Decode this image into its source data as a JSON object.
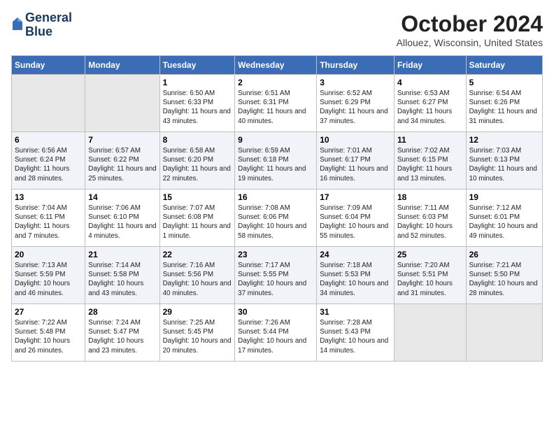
{
  "header": {
    "logo_line1": "General",
    "logo_line2": "Blue",
    "title": "October 2024",
    "subtitle": "Allouez, Wisconsin, United States"
  },
  "days_of_week": [
    "Sunday",
    "Monday",
    "Tuesday",
    "Wednesday",
    "Thursday",
    "Friday",
    "Saturday"
  ],
  "weeks": [
    [
      {
        "day": "",
        "empty": true
      },
      {
        "day": "",
        "empty": true
      },
      {
        "day": "1",
        "sunrise": "Sunrise: 6:50 AM",
        "sunset": "Sunset: 6:33 PM",
        "daylight": "Daylight: 11 hours and 43 minutes."
      },
      {
        "day": "2",
        "sunrise": "Sunrise: 6:51 AM",
        "sunset": "Sunset: 6:31 PM",
        "daylight": "Daylight: 11 hours and 40 minutes."
      },
      {
        "day": "3",
        "sunrise": "Sunrise: 6:52 AM",
        "sunset": "Sunset: 6:29 PM",
        "daylight": "Daylight: 11 hours and 37 minutes."
      },
      {
        "day": "4",
        "sunrise": "Sunrise: 6:53 AM",
        "sunset": "Sunset: 6:27 PM",
        "daylight": "Daylight: 11 hours and 34 minutes."
      },
      {
        "day": "5",
        "sunrise": "Sunrise: 6:54 AM",
        "sunset": "Sunset: 6:26 PM",
        "daylight": "Daylight: 11 hours and 31 minutes."
      }
    ],
    [
      {
        "day": "6",
        "sunrise": "Sunrise: 6:56 AM",
        "sunset": "Sunset: 6:24 PM",
        "daylight": "Daylight: 11 hours and 28 minutes."
      },
      {
        "day": "7",
        "sunrise": "Sunrise: 6:57 AM",
        "sunset": "Sunset: 6:22 PM",
        "daylight": "Daylight: 11 hours and 25 minutes."
      },
      {
        "day": "8",
        "sunrise": "Sunrise: 6:58 AM",
        "sunset": "Sunset: 6:20 PM",
        "daylight": "Daylight: 11 hours and 22 minutes."
      },
      {
        "day": "9",
        "sunrise": "Sunrise: 6:59 AM",
        "sunset": "Sunset: 6:18 PM",
        "daylight": "Daylight: 11 hours and 19 minutes."
      },
      {
        "day": "10",
        "sunrise": "Sunrise: 7:01 AM",
        "sunset": "Sunset: 6:17 PM",
        "daylight": "Daylight: 11 hours and 16 minutes."
      },
      {
        "day": "11",
        "sunrise": "Sunrise: 7:02 AM",
        "sunset": "Sunset: 6:15 PM",
        "daylight": "Daylight: 11 hours and 13 minutes."
      },
      {
        "day": "12",
        "sunrise": "Sunrise: 7:03 AM",
        "sunset": "Sunset: 6:13 PM",
        "daylight": "Daylight: 11 hours and 10 minutes."
      }
    ],
    [
      {
        "day": "13",
        "sunrise": "Sunrise: 7:04 AM",
        "sunset": "Sunset: 6:11 PM",
        "daylight": "Daylight: 11 hours and 7 minutes."
      },
      {
        "day": "14",
        "sunrise": "Sunrise: 7:06 AM",
        "sunset": "Sunset: 6:10 PM",
        "daylight": "Daylight: 11 hours and 4 minutes."
      },
      {
        "day": "15",
        "sunrise": "Sunrise: 7:07 AM",
        "sunset": "Sunset: 6:08 PM",
        "daylight": "Daylight: 11 hours and 1 minute."
      },
      {
        "day": "16",
        "sunrise": "Sunrise: 7:08 AM",
        "sunset": "Sunset: 6:06 PM",
        "daylight": "Daylight: 10 hours and 58 minutes."
      },
      {
        "day": "17",
        "sunrise": "Sunrise: 7:09 AM",
        "sunset": "Sunset: 6:04 PM",
        "daylight": "Daylight: 10 hours and 55 minutes."
      },
      {
        "day": "18",
        "sunrise": "Sunrise: 7:11 AM",
        "sunset": "Sunset: 6:03 PM",
        "daylight": "Daylight: 10 hours and 52 minutes."
      },
      {
        "day": "19",
        "sunrise": "Sunrise: 7:12 AM",
        "sunset": "Sunset: 6:01 PM",
        "daylight": "Daylight: 10 hours and 49 minutes."
      }
    ],
    [
      {
        "day": "20",
        "sunrise": "Sunrise: 7:13 AM",
        "sunset": "Sunset: 5:59 PM",
        "daylight": "Daylight: 10 hours and 46 minutes."
      },
      {
        "day": "21",
        "sunrise": "Sunrise: 7:14 AM",
        "sunset": "Sunset: 5:58 PM",
        "daylight": "Daylight: 10 hours and 43 minutes."
      },
      {
        "day": "22",
        "sunrise": "Sunrise: 7:16 AM",
        "sunset": "Sunset: 5:56 PM",
        "daylight": "Daylight: 10 hours and 40 minutes."
      },
      {
        "day": "23",
        "sunrise": "Sunrise: 7:17 AM",
        "sunset": "Sunset: 5:55 PM",
        "daylight": "Daylight: 10 hours and 37 minutes."
      },
      {
        "day": "24",
        "sunrise": "Sunrise: 7:18 AM",
        "sunset": "Sunset: 5:53 PM",
        "daylight": "Daylight: 10 hours and 34 minutes."
      },
      {
        "day": "25",
        "sunrise": "Sunrise: 7:20 AM",
        "sunset": "Sunset: 5:51 PM",
        "daylight": "Daylight: 10 hours and 31 minutes."
      },
      {
        "day": "26",
        "sunrise": "Sunrise: 7:21 AM",
        "sunset": "Sunset: 5:50 PM",
        "daylight": "Daylight: 10 hours and 28 minutes."
      }
    ],
    [
      {
        "day": "27",
        "sunrise": "Sunrise: 7:22 AM",
        "sunset": "Sunset: 5:48 PM",
        "daylight": "Daylight: 10 hours and 26 minutes."
      },
      {
        "day": "28",
        "sunrise": "Sunrise: 7:24 AM",
        "sunset": "Sunset: 5:47 PM",
        "daylight": "Daylight: 10 hours and 23 minutes."
      },
      {
        "day": "29",
        "sunrise": "Sunrise: 7:25 AM",
        "sunset": "Sunset: 5:45 PM",
        "daylight": "Daylight: 10 hours and 20 minutes."
      },
      {
        "day": "30",
        "sunrise": "Sunrise: 7:26 AM",
        "sunset": "Sunset: 5:44 PM",
        "daylight": "Daylight: 10 hours and 17 minutes."
      },
      {
        "day": "31",
        "sunrise": "Sunrise: 7:28 AM",
        "sunset": "Sunset: 5:43 PM",
        "daylight": "Daylight: 10 hours and 14 minutes."
      },
      {
        "day": "",
        "empty": true
      },
      {
        "day": "",
        "empty": true
      }
    ]
  ]
}
